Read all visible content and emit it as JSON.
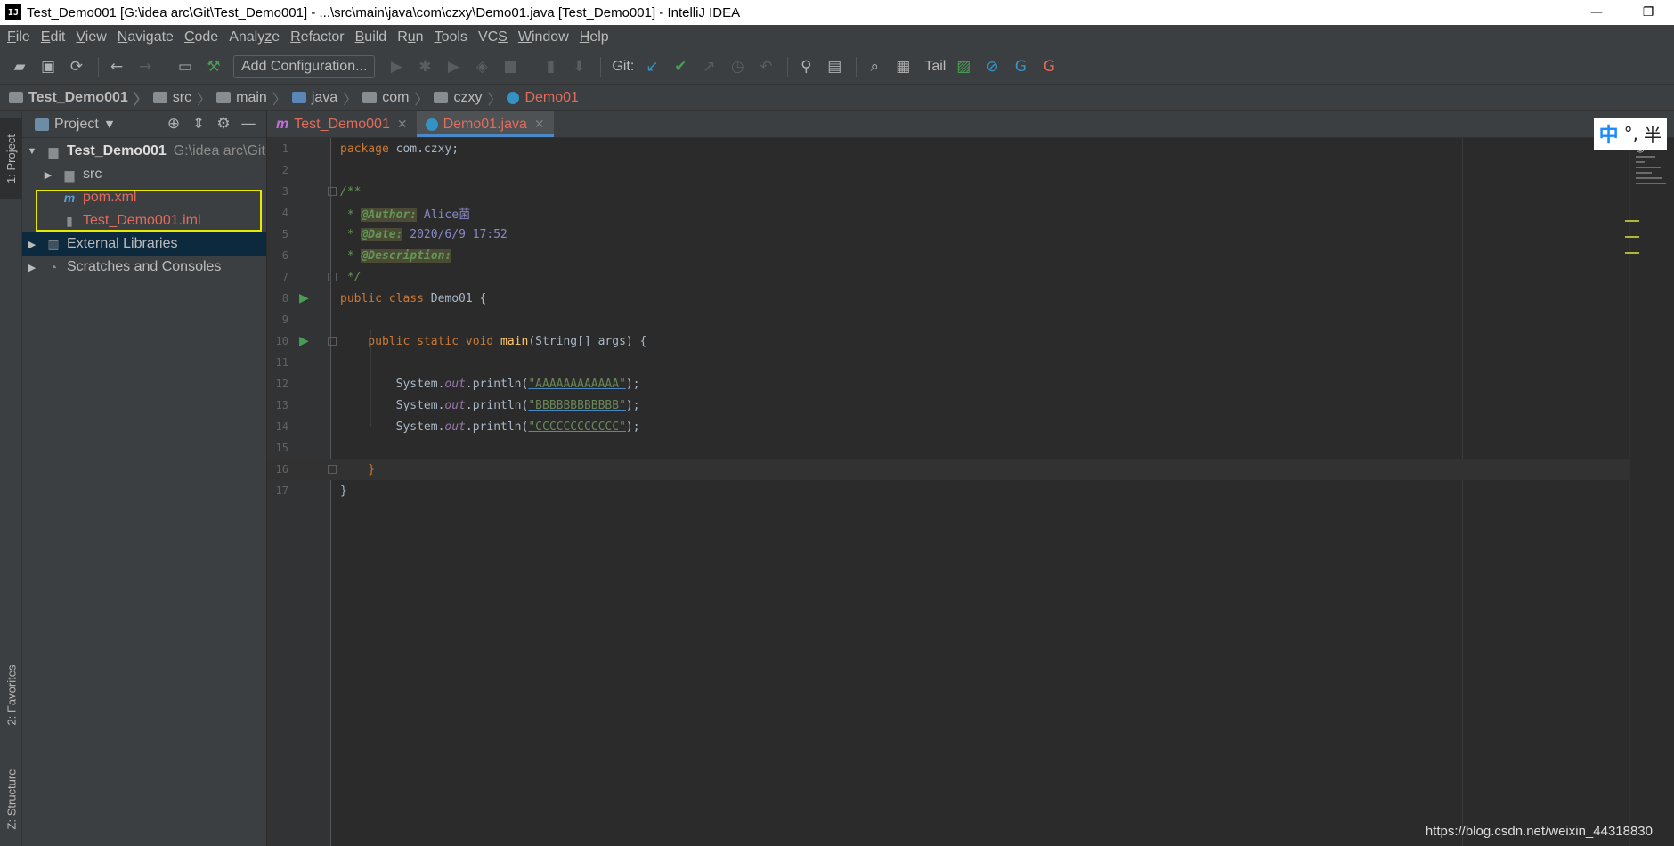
{
  "window": {
    "title": "Test_Demo001 [G:\\idea arc\\Git\\Test_Demo001] - ...\\src\\main\\java\\com\\czxy\\Demo01.java [Test_Demo001] - IntelliJ IDEA",
    "logo": "IJ",
    "minimize": "—",
    "restore": "❐"
  },
  "menu": [
    {
      "label": "File",
      "mnemonic": "F"
    },
    {
      "label": "Edit",
      "mnemonic": "E"
    },
    {
      "label": "View",
      "mnemonic": "V"
    },
    {
      "label": "Navigate",
      "mnemonic": "N"
    },
    {
      "label": "Code",
      "mnemonic": "C"
    },
    {
      "label": "Analyze",
      "mnemonic": "z"
    },
    {
      "label": "Refactor",
      "mnemonic": "R"
    },
    {
      "label": "Build",
      "mnemonic": "B"
    },
    {
      "label": "Run",
      "mnemonic": "u"
    },
    {
      "label": "Tools",
      "mnemonic": "T"
    },
    {
      "label": "VCS",
      "mnemonic": "S"
    },
    {
      "label": "Window",
      "mnemonic": "W"
    },
    {
      "label": "Help",
      "mnemonic": "H"
    }
  ],
  "toolbar": {
    "add_config": "Add Configuration...",
    "git_label": "Git:",
    "tail_label": "Tail"
  },
  "breadcrumb": [
    "Test_Demo001",
    "src",
    "main",
    "java",
    "com",
    "czxy",
    "Demo01"
  ],
  "left_strip": {
    "project_tab": "1: Project",
    "favorites_tab": "2: Favorites",
    "structure_tab": "Z: Structure"
  },
  "project_panel": {
    "header": "Project",
    "root": {
      "name": "Test_Demo001",
      "path": "G:\\idea arc\\Git"
    },
    "items": [
      {
        "name": "src"
      },
      {
        "name": "pom.xml"
      },
      {
        "name": "Test_Demo001.iml"
      },
      {
        "name": "External Libraries"
      },
      {
        "name": "Scratches and Consoles"
      }
    ]
  },
  "tabs": [
    {
      "label": "Test_Demo001",
      "icon": "m"
    },
    {
      "label": "Demo01.java",
      "icon": "class-icon"
    }
  ],
  "code": {
    "line_numbers": [
      "1",
      "2",
      "3",
      "4",
      "5",
      "6",
      "7",
      "8",
      "9",
      "10",
      "11",
      "12",
      "13",
      "14",
      "15",
      "16",
      "17"
    ],
    "l1_kw": "package",
    "l1_rest": " com.czxy;",
    "l3": "/**",
    "l4_star": " * ",
    "l4_tag": "@Author:",
    "l4_val": " Alice菌",
    "l5_star": " * ",
    "l5_tag": "@Date:",
    "l5_val": " 2020/6/9 17:52",
    "l6_star": " * ",
    "l6_tag": "@Description:",
    "l7": " */",
    "l8_kw": "public class",
    "l8_rest": " Demo01 {",
    "l10_kw": "    public static void",
    "l10_method": " main",
    "l10_rest": "(String[] args) {",
    "l12_pre": "        System.",
    "l12_out": "out",
    "l12_mid": ".println(",
    "l12_str": "\"AAAAAAAAAAAA\"",
    "l12_end": ");",
    "l13_pre": "        System.",
    "l13_out": "out",
    "l13_mid": ".println(",
    "l13_str": "\"BBBBBBBBBBBB\"",
    "l13_end": ");",
    "l14_pre": "        System.",
    "l14_out": "out",
    "l14_mid": ".println(",
    "l14_str": "\"CCCCCCCCCCCC\"",
    "l14_end": ");",
    "l16": "    }",
    "l17": "}"
  },
  "ime": {
    "lang": "中",
    "punct": "°,",
    "width": "半"
  },
  "watermark": "https://blog.csdn.net/weixin_44318830",
  "colors": {
    "highlight_box": "#e8e800",
    "modified_file": "#e06c5c",
    "tab_underline": "#4a88c7"
  }
}
